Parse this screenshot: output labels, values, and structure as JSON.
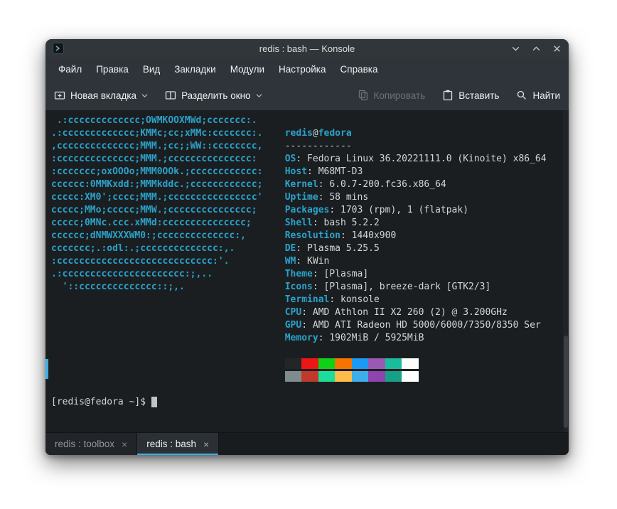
{
  "colors": {
    "accent": "#3daee9",
    "chrome_bg": "#2f343a",
    "terminal_bg": "#1b1e21",
    "ascii_cyan": "#2aa2ca",
    "terminal_text": "#d4d6d7"
  },
  "icons": {
    "app": "konsole-icon",
    "new_tab": "tab-new-icon",
    "split": "split-window-icon",
    "copy": "copy-icon",
    "paste": "paste-icon",
    "find": "search-icon",
    "minimize": "chevron-down-icon",
    "maximize": "chevron-up-icon",
    "close": "close-icon"
  },
  "window": {
    "title": "redis : bash — Konsole"
  },
  "menu_items": [
    "Файл",
    "Правка",
    "Вид",
    "Закладки",
    "Модули",
    "Настройка",
    "Справка"
  ],
  "toolbar": {
    "new_tab_label": "Новая вкладка",
    "split_label": "Разделить окно",
    "copy_label": "Копировать",
    "paste_label": "Вставить",
    "find_label": "Найти"
  },
  "terminal": {
    "ascii_lines": [
      " .:ccccccccccccc;OWMKOOXMWd;ccccccc:.",
      ".:ccccccccccccc;KMMc;cc;xMMc:ccccccc:.",
      ",cccccccccccccc;MMM.;cc;;WW::cccccccc,",
      ":cccccccccccccc;MMM.;ccccccccccccccc:",
      ":ccccccc;oxOOOo;MMM0OOk.;cccccccccccc:",
      "cccccc:0MMKxdd:;MMMkddc.;cccccccccccc;",
      "ccccc:XM0';cccc;MMM.;cccccccccccccccc'",
      "ccccc;MMo;ccccc;MMW.;ccccccccccccccc;",
      "ccccc;0MNc.ccc.xMMd:ccccccccccccccc;",
      "cccccc;dNMWXXXWM0:;cccccccccccccc:,",
      "ccccccc;.:odl:.;cccccccccccccc:,.",
      ":cccccccccccccccccccccccccccc:'.",
      ".:cccccccccccccccccccccc:;,..",
      "  '::cccccccccccccc::;,."
    ],
    "info_lines": [
      {
        "type": "user",
        "user": "redis",
        "sep": "@",
        "host": "fedora"
      },
      {
        "type": "plain",
        "text": "------------"
      },
      {
        "type": "kv",
        "label": "OS",
        "value": "Fedora Linux 36.20221111.0 (Kinoite) x86_64"
      },
      {
        "type": "kv",
        "label": "Host",
        "value": "M68MT-D3"
      },
      {
        "type": "kv",
        "label": "Kernel",
        "value": "6.0.7-200.fc36.x86_64"
      },
      {
        "type": "kv",
        "label": "Uptime",
        "value": "58 mins"
      },
      {
        "type": "kv",
        "label": "Packages",
        "value": "1703 (rpm), 1 (flatpak)"
      },
      {
        "type": "kv",
        "label": "Shell",
        "value": "bash 5.2.2"
      },
      {
        "type": "kv",
        "label": "Resolution",
        "value": "1440x900"
      },
      {
        "type": "kv",
        "label": "DE",
        "value": "Plasma 5.25.5"
      },
      {
        "type": "kv",
        "label": "WM",
        "value": "KWin"
      },
      {
        "type": "kv",
        "label": "Theme",
        "value": "[Plasma]"
      },
      {
        "type": "kv",
        "label": "Icons",
        "value": "[Plasma], breeze-dark [GTK2/3]"
      },
      {
        "type": "kv",
        "label": "Terminal",
        "value": "konsole"
      },
      {
        "type": "kv",
        "label": "CPU",
        "value": "AMD Athlon II X2 260 (2) @ 3.200GHz"
      },
      {
        "type": "kv",
        "label": "GPU",
        "value": "AMD ATI Radeon HD 5000/6000/7350/8350 Ser"
      },
      {
        "type": "kv",
        "label": "Memory",
        "value": "1902MiB / 5925MiB"
      }
    ],
    "palette_row1": [
      "#232627",
      "#ed1515",
      "#11d116",
      "#f67400",
      "#1d99f3",
      "#9b59b6",
      "#1abc9c",
      "#fcfcfc"
    ],
    "palette_row2": [
      "#7f8c8d",
      "#c0392b",
      "#1cdc9a",
      "#fdbc4b",
      "#3daee9",
      "#8e44ad",
      "#16a085",
      "#ffffff"
    ],
    "prompt": "[redis@fedora ~]$ "
  },
  "tabs": [
    {
      "label": "redis : toolbox",
      "close": "×",
      "active": false
    },
    {
      "label": "redis : bash",
      "close": "×",
      "active": true
    }
  ]
}
